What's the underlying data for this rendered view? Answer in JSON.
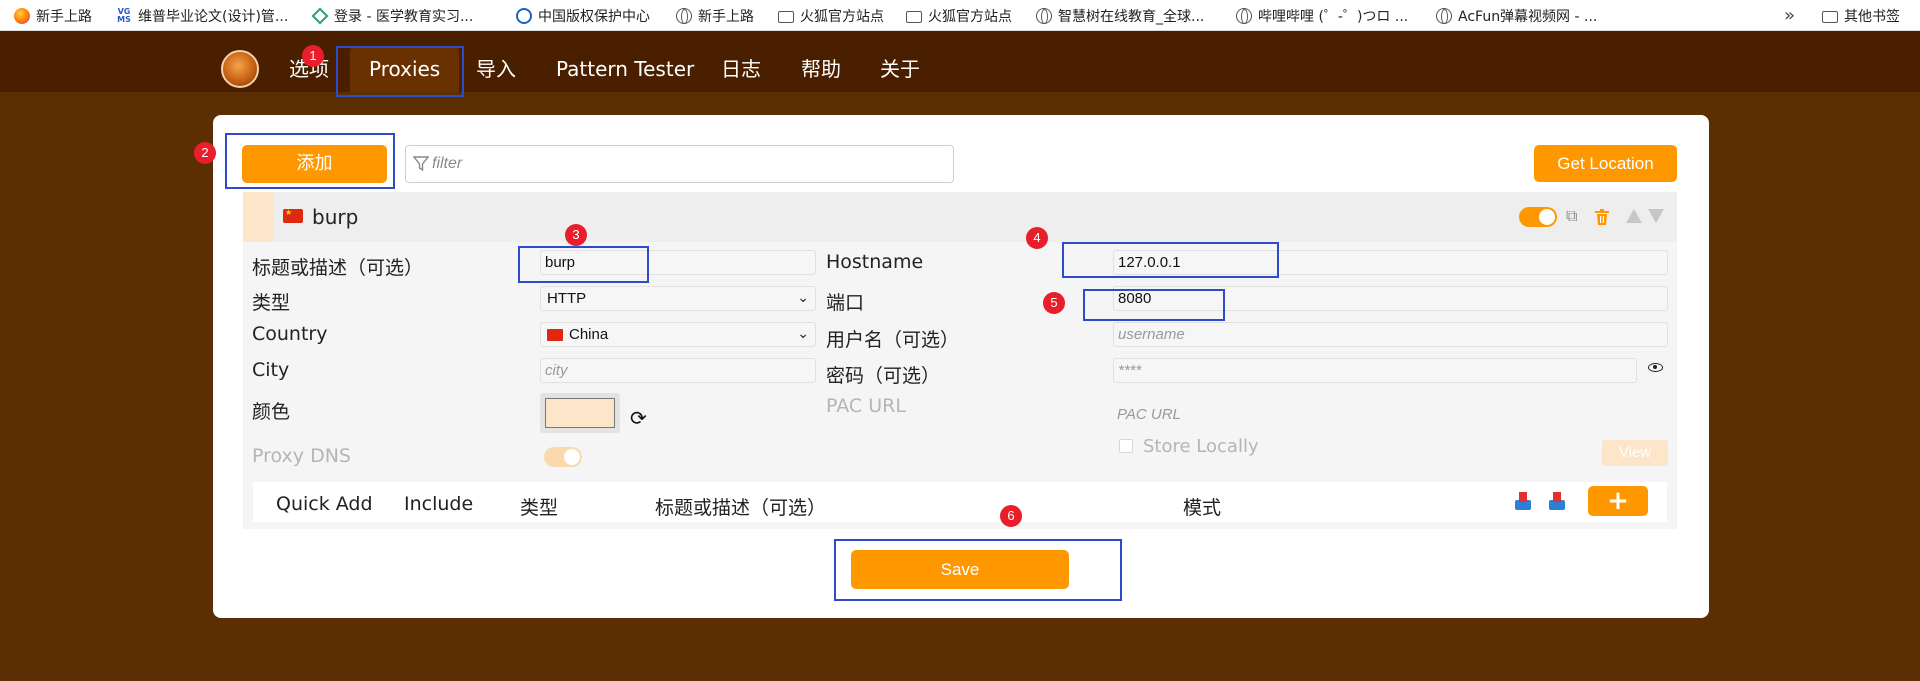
{
  "bookmarks": {
    "items": [
      {
        "label": "新手上路",
        "icon": "firefox-icon"
      },
      {
        "label": "维普毕业论文(设计)管...",
        "icon": "vgms-icon"
      },
      {
        "label": "登录 - 医学教育实习...",
        "icon": "diamond-icon"
      },
      {
        "label": "中国版权保护中心",
        "icon": "copyright-icon"
      },
      {
        "label": "新手上路",
        "icon": "globe-icon"
      },
      {
        "label": "火狐官方站点",
        "icon": "folder-icon"
      },
      {
        "label": "火狐官方站点",
        "icon": "folder-icon"
      },
      {
        "label": "智慧树在线教育_全球...",
        "icon": "globe-icon"
      },
      {
        "label": "哔哩哔哩 (゜-゜)つロ ...",
        "icon": "globe-icon"
      },
      {
        "label": "AcFun弹幕视频网 - ...",
        "icon": "globe-icon"
      }
    ],
    "overflow": "»",
    "other_label": "其他书签"
  },
  "nav": {
    "tabs": [
      "选项",
      "Proxies",
      "导入",
      "Pattern Tester",
      "日志",
      "帮助",
      "关于"
    ],
    "active": "Proxies"
  },
  "toolbar": {
    "add_label": "添加",
    "filter_placeholder": "filter",
    "get_location_label": "Get Location"
  },
  "proxy": {
    "name": "burp",
    "enabled": true,
    "form": {
      "title_label": "标题或描述（可选）",
      "title_value": "burp",
      "type_label": "类型",
      "type_value": "HTTP",
      "country_label": "Country",
      "country_value": "China",
      "city_label": "City",
      "city_placeholder": "city",
      "color_label": "颜色",
      "color_value": "#fde5c9",
      "proxy_dns_label": "Proxy DNS",
      "hostname_label": "Hostname",
      "hostname_value": "127.0.0.1",
      "port_label": "端口",
      "port_value": "8080",
      "username_label": "用户名（可选）",
      "username_placeholder": "username",
      "password_label": "密码（可选）",
      "password_placeholder": "****",
      "pac_url_label": "PAC URL",
      "pac_url_placeholder": "PAC URL",
      "store_locally_label": "Store Locally",
      "view_label": "View"
    },
    "patterns": {
      "headers": [
        "Quick Add",
        "Include",
        "类型",
        "标题或描述（可选）",
        "模式"
      ],
      "add_symbol": "+"
    }
  },
  "save_label": "Save",
  "annotations": [
    "1",
    "2",
    "3",
    "4",
    "5",
    "6"
  ],
  "colors": {
    "accent": "#ff9800",
    "header": "#491f00",
    "background": "#5b2e03",
    "annotation_box": "#2e4bcc",
    "annotation_badge": "#e81e2a"
  }
}
